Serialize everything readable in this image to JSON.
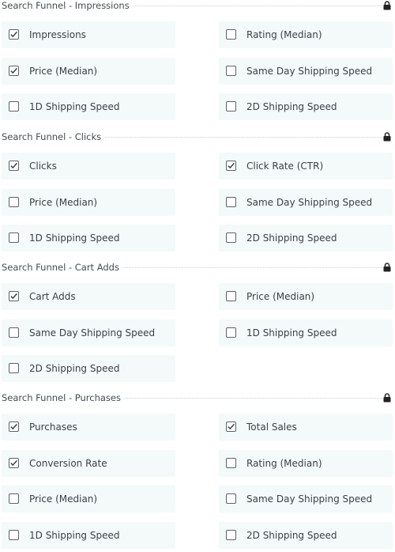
{
  "sections": [
    {
      "title": "Search Funnel - Impressions",
      "lock_icon": "lock-icon",
      "options": [
        {
          "label": "Impressions",
          "checked": true
        },
        {
          "label": "Rating (Median)",
          "checked": false
        },
        {
          "label": "Price (Median)",
          "checked": true
        },
        {
          "label": "Same Day Shipping Speed",
          "checked": false
        },
        {
          "label": "1D Shipping Speed",
          "checked": false
        },
        {
          "label": "2D Shipping Speed",
          "checked": false
        }
      ]
    },
    {
      "title": "Search Funnel - Clicks",
      "lock_icon": "lock-icon",
      "options": [
        {
          "label": "Clicks",
          "checked": true
        },
        {
          "label": "Click Rate (CTR)",
          "checked": true
        },
        {
          "label": "Price (Median)",
          "checked": false
        },
        {
          "label": "Same Day Shipping Speed",
          "checked": false
        },
        {
          "label": "1D Shipping Speed",
          "checked": false
        },
        {
          "label": "2D Shipping Speed",
          "checked": false
        }
      ]
    },
    {
      "title": "Search Funnel - Cart Adds",
      "lock_icon": "lock-icon",
      "options": [
        {
          "label": "Cart Adds",
          "checked": true
        },
        {
          "label": "Price (Median)",
          "checked": false
        },
        {
          "label": "Same Day Shipping Speed",
          "checked": false
        },
        {
          "label": "1D Shipping Speed",
          "checked": false
        },
        {
          "label": "2D Shipping Speed",
          "checked": false
        }
      ]
    },
    {
      "title": "Search Funnel - Purchases",
      "lock_icon": "lock-icon",
      "options": [
        {
          "label": "Purchases",
          "checked": true
        },
        {
          "label": "Total Sales",
          "checked": true
        },
        {
          "label": "Conversion Rate",
          "checked": true
        },
        {
          "label": "Rating (Median)",
          "checked": false
        },
        {
          "label": "Price (Median)",
          "checked": false
        },
        {
          "label": "Same Day Shipping Speed",
          "checked": false
        },
        {
          "label": "1D Shipping Speed",
          "checked": false
        },
        {
          "label": "2D Shipping Speed",
          "checked": false
        }
      ]
    }
  ],
  "colors": {
    "option_background": "#f4f9f9",
    "checkbox_border": "#5c6368",
    "check_mark": "#2f3a40",
    "text": "#3a4247"
  }
}
